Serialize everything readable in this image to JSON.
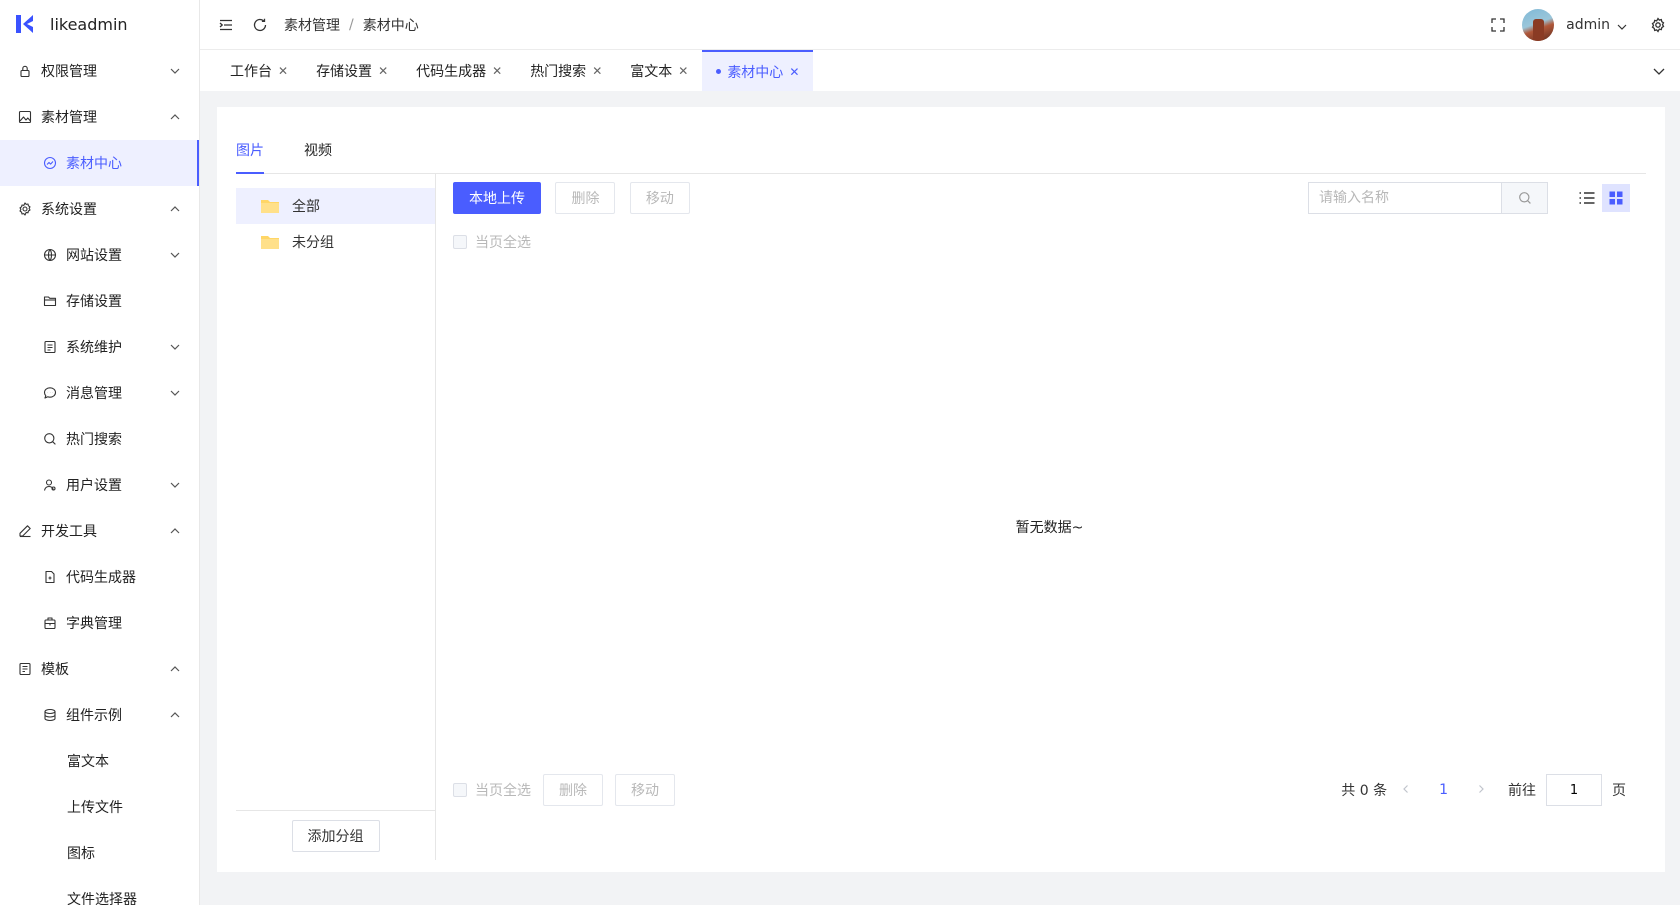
{
  "app": {
    "name": "likeadmin"
  },
  "sidebar": {
    "items": [
      {
        "label": "权限管理",
        "level": 1,
        "icon": "lock-icon",
        "arrow": "down"
      },
      {
        "label": "素材管理",
        "level": 1,
        "icon": "image-icon",
        "arrow": "up"
      },
      {
        "label": "素材中心",
        "level": 2,
        "icon": "material-icon",
        "active": true
      },
      {
        "label": "系统设置",
        "level": 1,
        "icon": "gear-icon",
        "arrow": "up"
      },
      {
        "label": "网站设置",
        "level": 2,
        "icon": "globe-icon",
        "arrow": "down"
      },
      {
        "label": "存储设置",
        "level": 2,
        "icon": "folder-open-icon"
      },
      {
        "label": "系统维护",
        "level": 2,
        "icon": "maintenance-icon",
        "arrow": "down"
      },
      {
        "label": "消息管理",
        "level": 2,
        "icon": "message-icon",
        "arrow": "down"
      },
      {
        "label": "热门搜索",
        "level": 2,
        "icon": "search-icon"
      },
      {
        "label": "用户设置",
        "level": 2,
        "icon": "user-icon",
        "arrow": "down"
      },
      {
        "label": "开发工具",
        "level": 1,
        "icon": "pen-icon",
        "arrow": "up"
      },
      {
        "label": "代码生成器",
        "level": 2,
        "icon": "file-code-icon"
      },
      {
        "label": "字典管理",
        "level": 2,
        "icon": "dictionary-icon"
      },
      {
        "label": "模板",
        "level": 1,
        "icon": "template-icon",
        "arrow": "up"
      },
      {
        "label": "组件示例",
        "level": 2,
        "icon": "database-icon",
        "arrow": "up"
      },
      {
        "label": "富文本",
        "level": 3
      },
      {
        "label": "上传文件",
        "level": 3
      },
      {
        "label": "图标",
        "level": 3
      },
      {
        "label": "文件选择器",
        "level": 3
      }
    ]
  },
  "header": {
    "breadcrumb": [
      "素材管理",
      "素材中心"
    ],
    "separator": "/",
    "username": "admin"
  },
  "tabs": [
    {
      "label": "工作台"
    },
    {
      "label": "存储设置"
    },
    {
      "label": "代码生成器"
    },
    {
      "label": "热门搜索"
    },
    {
      "label": "富文本"
    },
    {
      "label": "素材中心",
      "active": true
    }
  ],
  "content": {
    "tabs": [
      {
        "label": "图片",
        "active": true
      },
      {
        "label": "视频"
      }
    ],
    "groups": [
      {
        "label": "全部",
        "active": true
      },
      {
        "label": "未分组"
      }
    ],
    "add_group_label": "添加分组",
    "toolbar": {
      "upload_label": "本地上传",
      "delete_label": "删除",
      "move_label": "移动",
      "search_placeholder": "请输入名称"
    },
    "select_all_label": "当页全选",
    "empty_text": "暂无数据~",
    "footer": {
      "select_all_label": "当页全选",
      "delete_label": "删除",
      "move_label": "移动"
    },
    "pagination": {
      "total_text": "共 0 条",
      "current_page": "1",
      "goto_label": "前往",
      "goto_value": "1",
      "page_suffix": "页"
    }
  },
  "colors": {
    "primary": "#4a5dff",
    "active_bg": "#eef0ff",
    "folder": "#ffd666"
  }
}
